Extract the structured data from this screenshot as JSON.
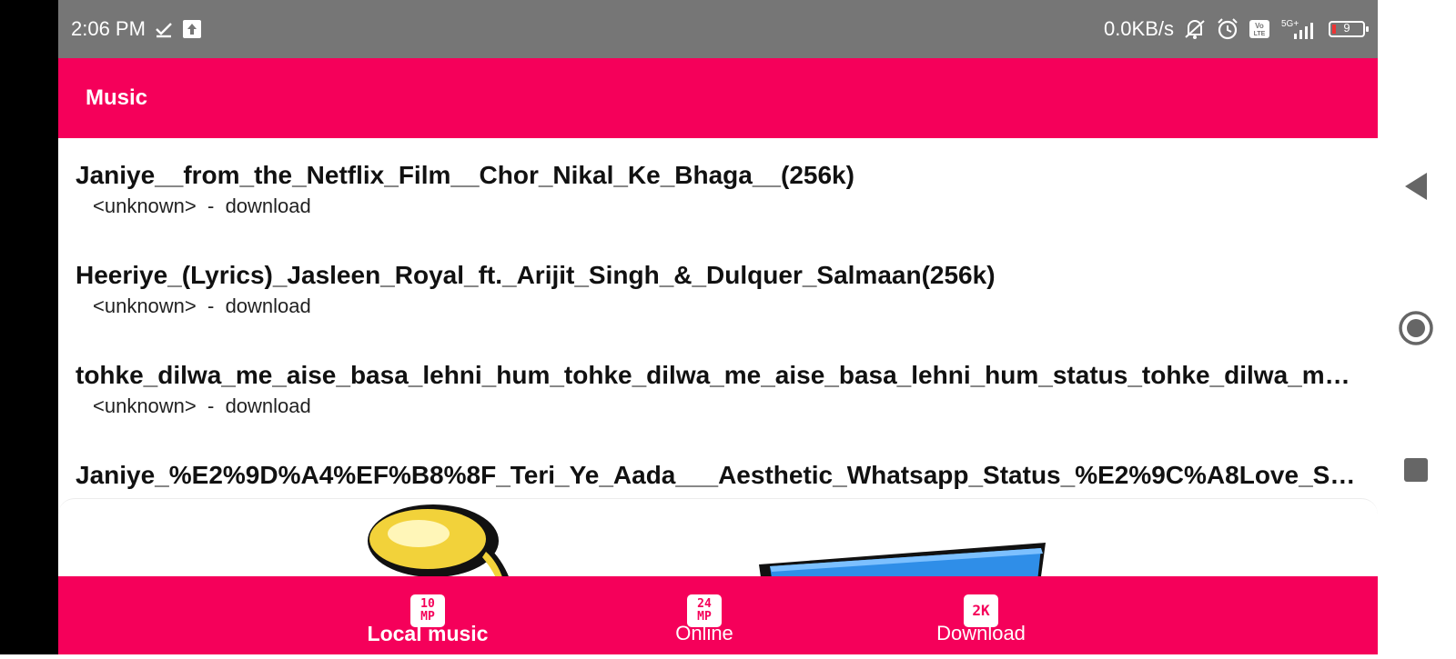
{
  "status_bar": {
    "time": "2:06 PM",
    "net_speed": "0.0KB/s",
    "battery_level": "9",
    "network_type": "5G+",
    "volte_label": "Vo LTE",
    "icons": [
      "check-download-icon",
      "upload-icon",
      "mute-icon",
      "alarm-icon",
      "volte-icon",
      "signal-icon",
      "battery-icon"
    ]
  },
  "toolbar": {
    "title": "Music"
  },
  "songs": [
    {
      "title": "Janiye__from_the_Netflix_Film__Chor_Nikal_Ke_Bhaga__(256k)",
      "artist": "<unknown>",
      "separator": "-",
      "album": "download"
    },
    {
      "title": "Heeriye_(Lyrics)_Jasleen_Royal_ft._Arijit_Singh_&_Dulquer_Salmaan(256k)",
      "artist": "<unknown>",
      "separator": "-",
      "album": "download"
    },
    {
      "title": "tohke_dilwa_me_aise_basa_lehni_hum_tohke_dilwa_me_aise_basa_lehni_hum_status_tohke_dilwa_m…",
      "artist": "<unknown>",
      "separator": "-",
      "album": "download"
    },
    {
      "title": "Janiye_%E2%9D%A4%EF%B8%8F_Teri_Ye_Aada___Aesthetic_Whatsapp_Status_%E2%9C%A8Love_St…",
      "artist": "",
      "separator": "",
      "album": ""
    }
  ],
  "bottom_nav": {
    "items": [
      {
        "label": "Local music",
        "badge_top": "10",
        "badge_bottom": "MP",
        "active": true
      },
      {
        "label": "Online",
        "badge_top": "24",
        "badge_bottom": "MP",
        "active": false
      },
      {
        "label": "Download",
        "badge_top": "2K",
        "badge_bottom": "",
        "active": false
      }
    ]
  },
  "colors": {
    "accent": "#f5005a",
    "status_bar": "#767676",
    "background": "#ffffff",
    "text_primary": "#111111"
  }
}
